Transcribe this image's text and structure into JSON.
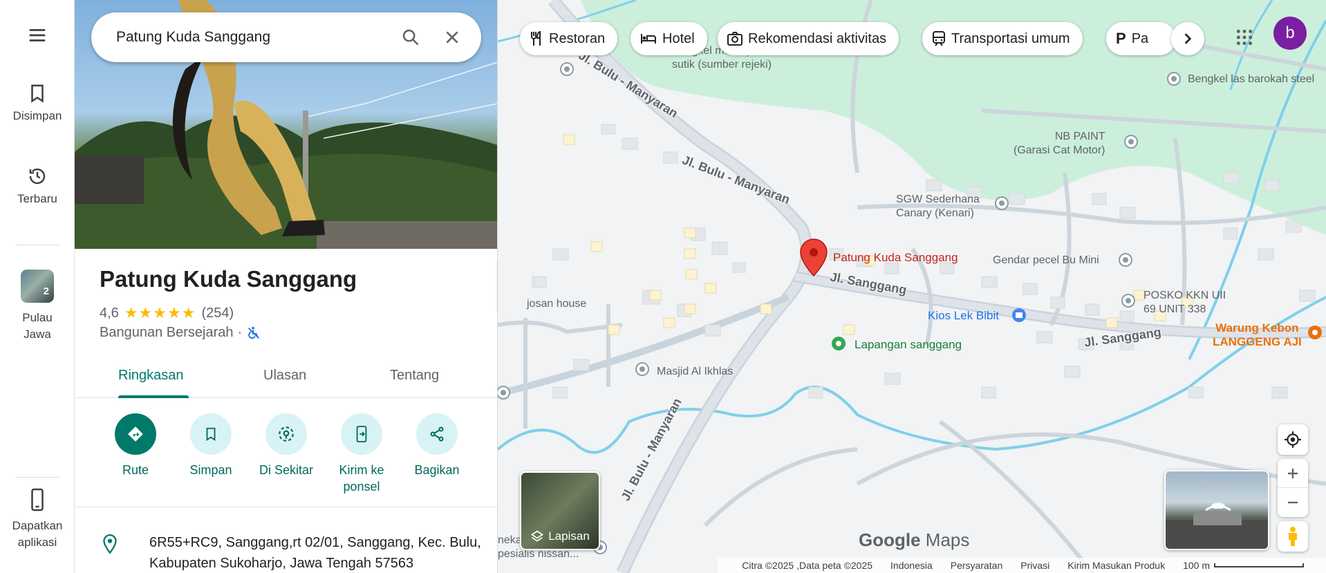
{
  "rail": {
    "saved": "Disimpan",
    "recent": "Terbaru",
    "collection_label": "Pulau Jawa",
    "collection_count": "2",
    "get_app": "Dapatkan aplikasi"
  },
  "search": {
    "value": "Patung Kuda Sanggang"
  },
  "place": {
    "title": "Patung Kuda Sanggang",
    "rating": "4,6",
    "reviews": "(254)",
    "stars_value": 4.6,
    "category": "Bangunan Bersejarah",
    "separator": "·"
  },
  "tabs": [
    "Ringkasan",
    "Ulasan",
    "Tentang"
  ],
  "actions": {
    "route": "Rute",
    "save": "Simpan",
    "nearby": "Di Sekitar",
    "send": "Kirim ke ponsel",
    "share": "Bagikan"
  },
  "address": "6R55+RC9, Sanggang,rt 02/01, Sanggang, Kec. Bulu, Kabupaten Sukoharjo, Jawa Tengah 57563",
  "chips": {
    "restaurant": "Restoran",
    "hotel": "Hotel",
    "activities": "Rekomendasi aktivitas",
    "transit": "Transportasi umum",
    "parking": "Pa"
  },
  "avatar_letter": "b",
  "map": {
    "labels": {
      "bengkel_motor": "Bengkel motor pak",
      "bengkel_motor2": "sutik (sumber rejeki)",
      "bengkel_las": "Bengkel las barokah steel",
      "nb_paint": "NB PAINT",
      "nb_paint2": "(Garasi Cat Motor)",
      "sgw": "SGW Sederhana",
      "sgw2": "Canary (Kenari)",
      "pin": "Patung Kuda Sanggang",
      "gendar": "Gendar pecel Bu Mini",
      "posko": "POSKO KKN UII",
      "posko2": "69 UNIT 338",
      "kios": "Kios Lek Bibit",
      "warung": "Warung Kebon",
      "warung2": "LANGGENG AJI",
      "josan": "josan house",
      "lapangan": "Lapangan sanggang",
      "masjid": "Masjid Al Ikhlas",
      "nekar": "nekar",
      "nekar2": "pesialis nissan..."
    },
    "roads": {
      "bulu_manyaran_1": "Jl. Bulu - Manyaran",
      "bulu_manyaran_2": "Jl. Bulu - Manyaran",
      "bulu_manyaran_3": "Jl. Bulu - Manyaran",
      "sanggang_1": "Jl. Sanggang",
      "sanggang_2": "Jl. Sanggang"
    },
    "layers": "Lapisan",
    "brand_google": "Google",
    "brand_maps": "Maps"
  },
  "footer": {
    "copyright": "Citra ©2025 ,Data peta ©2025",
    "country": "Indonesia",
    "terms": "Persyaratan",
    "privacy": "Privasi",
    "feedback": "Kirim Masukan Produk",
    "scale": "100 m"
  },
  "colors": {
    "accent": "#00796b",
    "action_bg": "#d8f3f5",
    "pin": "#ea4335",
    "water": "#7fd0ea",
    "park": "#ccefdc",
    "avatar": "#7b1fa2"
  }
}
